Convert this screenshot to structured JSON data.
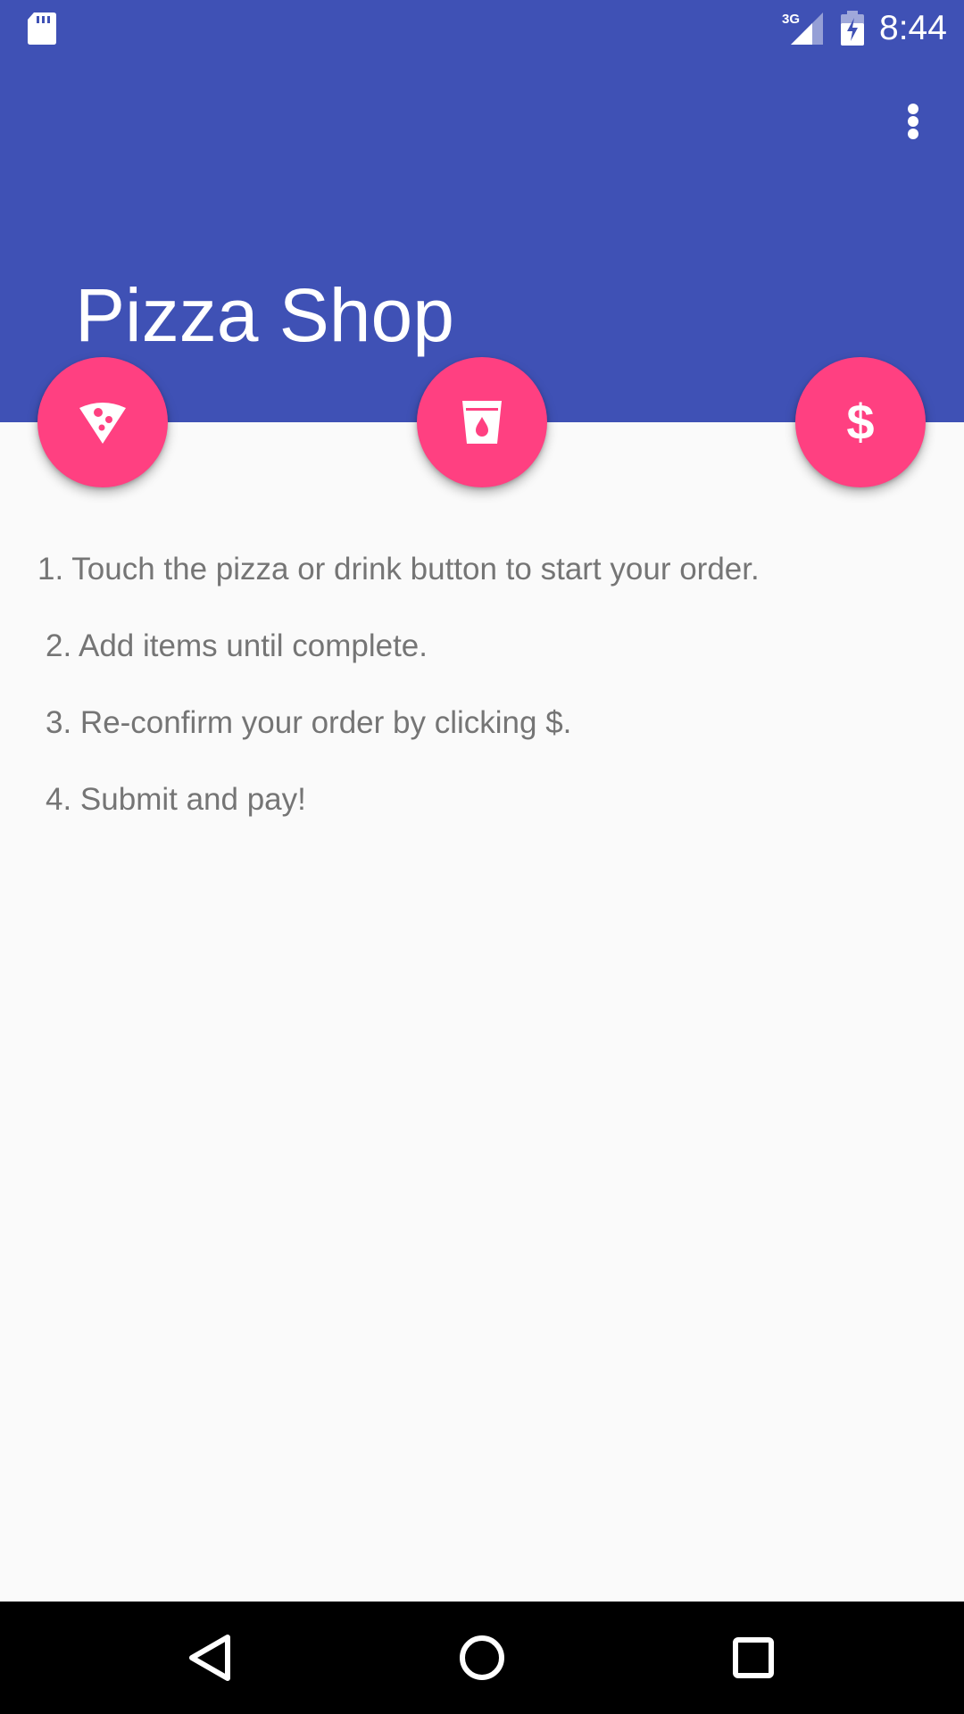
{
  "status_bar": {
    "time": "8:44",
    "network": "3G",
    "icons": [
      "sd-card-icon",
      "signal-3g-icon",
      "battery-charging-icon"
    ]
  },
  "app_bar": {
    "title": "Pizza Shop",
    "menu_icon": "more-vert-icon",
    "color": "#3F51B5"
  },
  "actions": {
    "accent_color": "#FF4081",
    "pizza": {
      "icon": "pizza-slice-icon"
    },
    "drink": {
      "icon": "drink-cup-icon"
    },
    "checkout": {
      "icon": "dollar-icon",
      "symbol": "$"
    }
  },
  "instructions": {
    "steps": [
      "1. Touch the pizza or drink button to start your order.",
      "2. Add items until complete.",
      "3. Re-confirm your order by clicking $.",
      "4. Submit and pay!"
    ]
  },
  "nav_bar": {
    "icons": [
      "back-icon",
      "home-icon",
      "recents-icon"
    ]
  }
}
